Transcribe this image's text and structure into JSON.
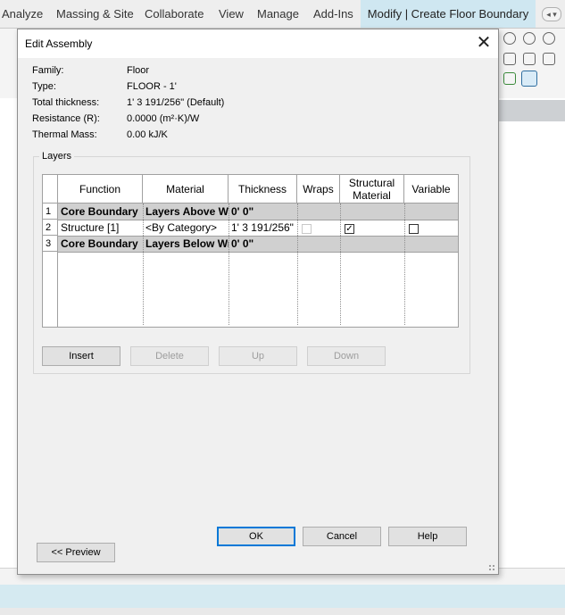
{
  "ribbon": {
    "tabs": [
      "Analyze",
      "Massing & Site",
      "Collaborate",
      "View",
      "Manage",
      "Add-Ins"
    ],
    "active_tab": "Modify | Create Floor Boundary"
  },
  "dialog": {
    "title": "Edit Assembly",
    "info": [
      {
        "label": "Family:",
        "value": "Floor"
      },
      {
        "label": "Type:",
        "value": "FLOOR - 1'"
      },
      {
        "label": "Total thickness:",
        "value": "1'  3 191/256\" (Default)"
      },
      {
        "label": "Resistance (R):",
        "value": "0.0000 (m²·K)/W"
      },
      {
        "label": "Thermal Mass:",
        "value": "0.00 kJ/K"
      }
    ],
    "layers_title": "Layers",
    "columns": [
      "Function",
      "Material",
      "Thickness",
      "Wraps",
      "Structural Material",
      "Variable"
    ],
    "rows": [
      {
        "num": "1",
        "function": "Core Boundary",
        "material": "Layers Above W",
        "thickness": "0'  0\"",
        "wraps": null,
        "structural": null,
        "variable": null,
        "core": true
      },
      {
        "num": "2",
        "function": "Structure [1]",
        "material": "<By Category>",
        "thickness": "1'  3 191/256\"",
        "wraps": false,
        "structural": true,
        "variable": false,
        "core": false
      },
      {
        "num": "3",
        "function": "Core Boundary",
        "material": "Layers Below Wr",
        "thickness": "0'  0\"",
        "wraps": null,
        "structural": null,
        "variable": null,
        "core": true
      }
    ],
    "buttons": {
      "insert": "Insert",
      "delete": "Delete",
      "up": "Up",
      "down": "Down",
      "ok": "OK",
      "cancel": "Cancel",
      "help": "Help",
      "preview": "<< Preview"
    }
  }
}
